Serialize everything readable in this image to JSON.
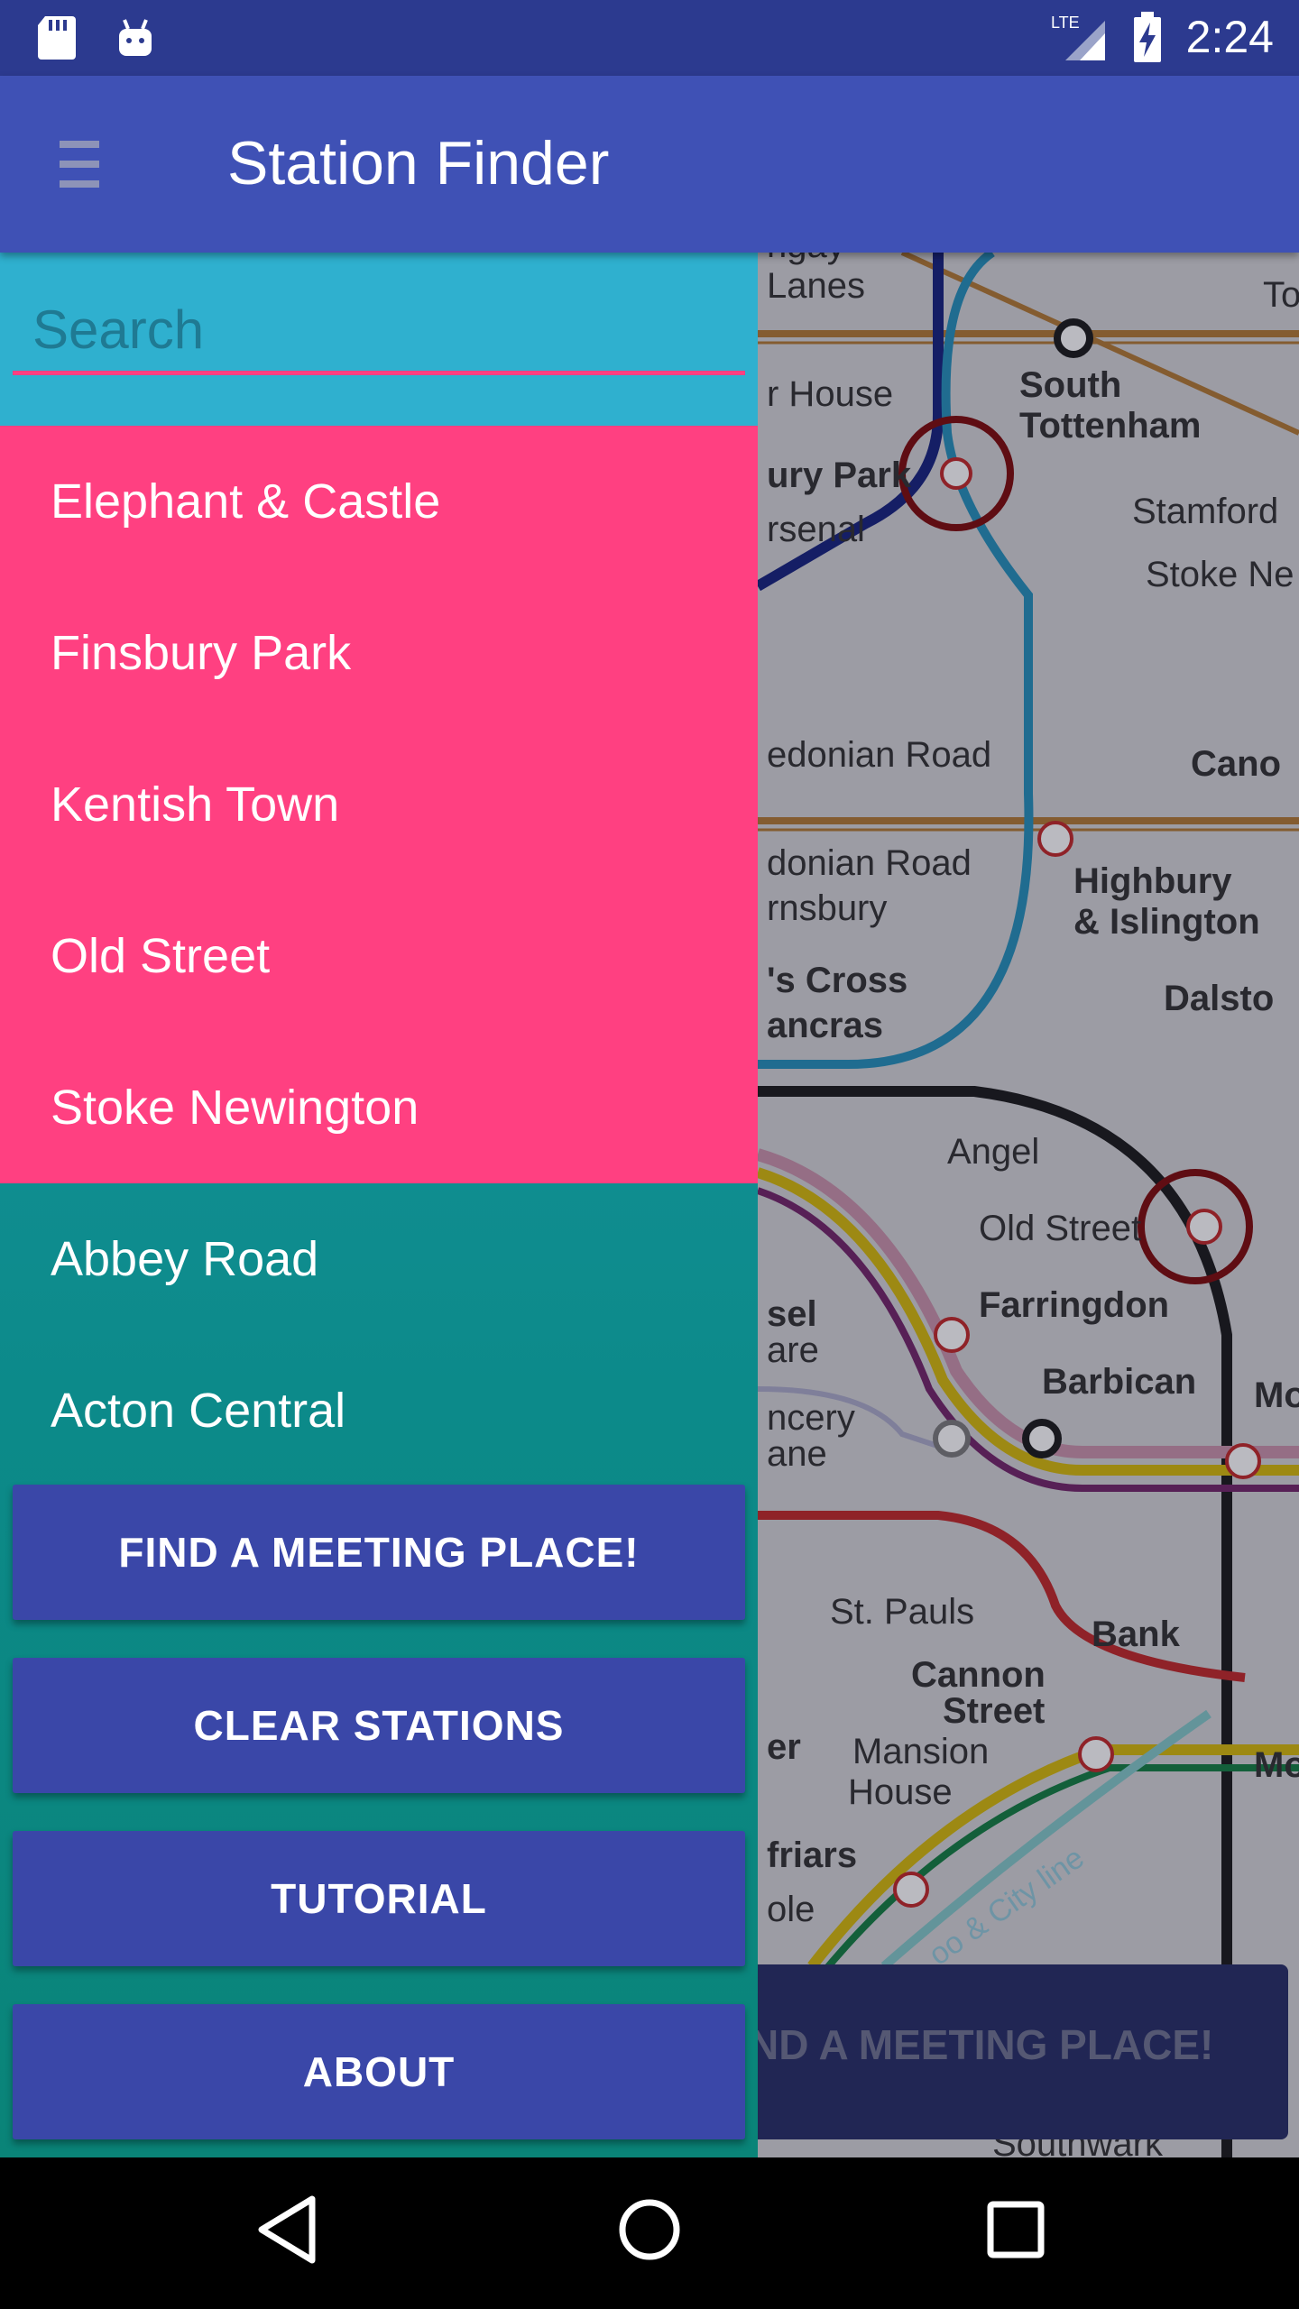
{
  "status_bar": {
    "time": "2:24",
    "network": "LTE",
    "icons": [
      "sd-card-icon",
      "android-icon",
      "signal-icon",
      "battery-charging-icon"
    ]
  },
  "toolbar": {
    "title": "Station Finder",
    "menu_icon": "hamburger-menu-icon"
  },
  "drawer": {
    "search": {
      "placeholder": "Search",
      "value": ""
    },
    "stations": [
      {
        "label": "Elephant & Castle",
        "selected": true
      },
      {
        "label": "Finsbury Park",
        "selected": true
      },
      {
        "label": "Kentish Town",
        "selected": true
      },
      {
        "label": "Old Street",
        "selected": true
      },
      {
        "label": "Stoke Newington",
        "selected": true
      },
      {
        "label": "Abbey Road",
        "selected": false
      },
      {
        "label": "Acton Central",
        "selected": false
      }
    ],
    "buttons": {
      "find": "FIND A MEETING PLACE!",
      "clear": "CLEAR STATIONS",
      "tutorial": "TUTORIAL",
      "about": "ABOUT"
    },
    "colors": {
      "selected": "#ff4081",
      "button": "#3a47a8",
      "accent": "#ff4081"
    }
  },
  "map": {
    "labels": {
      "l1": "ngay",
      "l2": "Lanes",
      "l3": "South",
      "l4": "Tottenham",
      "l5": "To",
      "l6": "r House",
      "l7": "ury Park",
      "l8": "Stamford",
      "l9": "rsenal",
      "l10": "Stoke Ne",
      "l11": "edonian Road",
      "l12": "Cano",
      "l13": "donian Road",
      "l14": "rnsbury",
      "l15": "Highbury",
      "l16": "& Islington",
      "l17": "'s Cross",
      "l18": "Dalsto",
      "l19": "ancras",
      "l20": "Angel",
      "l21": "Old Street",
      "l22": "sel",
      "l23": "are",
      "l24": "Farringdon",
      "l25": "ncery",
      "l26": "ane",
      "l27": "Barbican",
      "l28": "Mo",
      "l29": "St. Pauls",
      "l30": "Bank",
      "l31": "Cannon",
      "l32": "Street",
      "l33": "er",
      "l34": "Mansion",
      "l35": "House",
      "l36": "Mo",
      "l37": "friars",
      "l38": "ole",
      "l39": "oo & City line",
      "l40": "Southwark"
    },
    "background_button": "ND A MEETING PLACE!"
  },
  "nav_bar": {
    "icons": [
      "back-icon",
      "home-icon",
      "recents-icon"
    ]
  }
}
